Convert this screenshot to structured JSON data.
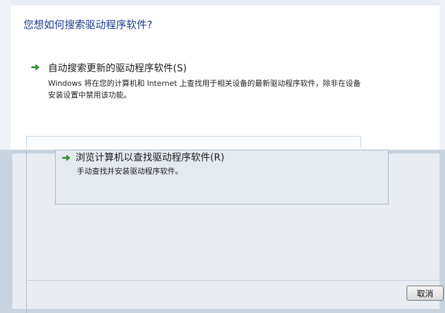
{
  "dialog": {
    "question": "您想如何搜索驱动程序软件?",
    "option_auto": {
      "title": "自动搜索更新的驱动程序软件(S)",
      "description": "Windows 将在您的计算机和 Internet 上查找用于相关设备的最新驱动程序软件，除非在设备安装设置中禁用该功能。"
    },
    "option_browse": {
      "title": "浏览计算机以查找驱动程序软件(R)",
      "description": "手动查找并安装驱动程序软件。"
    },
    "cancel_label": "取消"
  }
}
